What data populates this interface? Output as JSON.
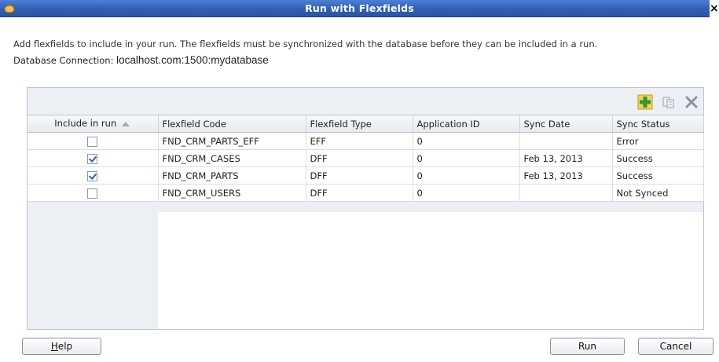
{
  "window": {
    "title": "Run with Flexfields",
    "close_glyph": "×"
  },
  "description": "Add flexfields to include in your run.  The flexfields must be synchronized with the database before they can be included in a run.",
  "database": {
    "label": "Database Connection: ",
    "value": "localhost.com:1500:mydatabase"
  },
  "toolbar": {
    "icons": [
      "add-icon",
      "sync-icon",
      "delete-icon"
    ]
  },
  "table": {
    "columns": [
      "Include in run",
      "Flexfield Code",
      "Flexfield Type",
      "Application ID",
      "Sync Date",
      "Sync Status"
    ],
    "sorted_column": "Include in run",
    "rows": [
      {
        "include": false,
        "code": "FND_CRM_PARTS_EFF",
        "type": "EFF",
        "app_id": "0",
        "sync_date": "",
        "status": "Error"
      },
      {
        "include": true,
        "code": "FND_CRM_CASES",
        "type": "DFF",
        "app_id": "0",
        "sync_date": "Feb 13, 2013",
        "status": "Success"
      },
      {
        "include": true,
        "code": "FND_CRM_PARTS",
        "type": "DFF",
        "app_id": "0",
        "sync_date": "Feb 13, 2013",
        "status": "Success"
      },
      {
        "include": false,
        "code": "FND_CRM_USERS",
        "type": "DFF",
        "app_id": "0",
        "sync_date": "",
        "status": "Not Synced"
      }
    ]
  },
  "buttons": {
    "help_mnemonic": "H",
    "help_rest": "elp",
    "run": "Run",
    "cancel": "Cancel"
  },
  "colors": {
    "titlebar": "#2f5fb4",
    "add_icon": "#2e9b2e",
    "checkbox_check": "#2f5fb4"
  }
}
